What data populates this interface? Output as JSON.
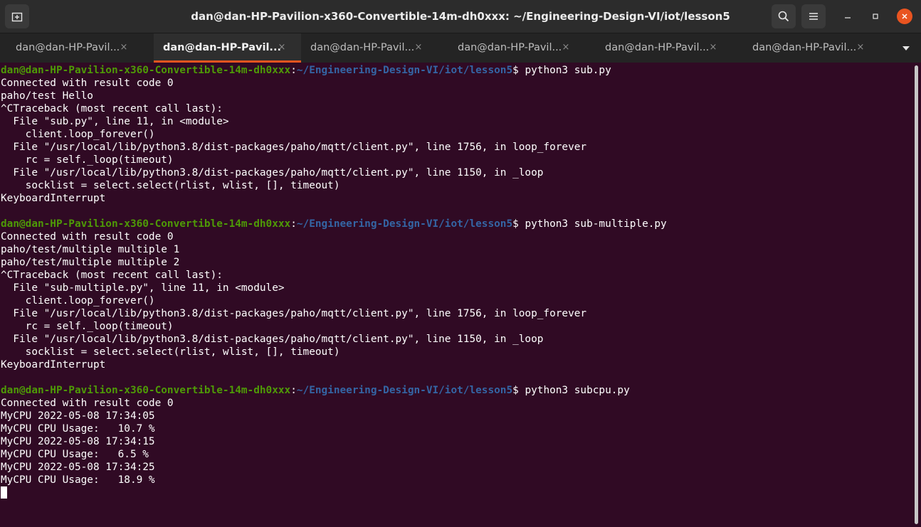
{
  "window": {
    "title": "dan@dan-HP-Pavilion-x360-Convertible-14m-dh0xxx: ~/Engineering-Design-VI/iot/lesson5",
    "icons": {
      "new_tab": "new-tab-icon",
      "search": "search-icon",
      "menu": "hamburger-menu-icon",
      "minimize": "minimize-icon",
      "maximize": "maximize-icon",
      "close": "close-icon"
    },
    "close_color": "#e95420"
  },
  "tabs": [
    {
      "label": "dan@dan-HP-Pavil...",
      "active": false
    },
    {
      "label": "dan@dan-HP-Pavil...",
      "active": true
    },
    {
      "label": "dan@dan-HP-Pavil...",
      "active": false
    },
    {
      "label": "dan@dan-HP-Pavil...",
      "active": false
    },
    {
      "label": "dan@dan-HP-Pavil...",
      "active": false
    },
    {
      "label": "dan@dan-HP-Pavil...",
      "active": false
    }
  ],
  "tab_close_glyph": "×",
  "terminal": {
    "background": "#300a24",
    "prompt_user": "dan@dan-HP-Pavilion-x360-Convertible-14m-dh0xxx",
    "prompt_sep": ":",
    "prompt_path": "~/Engineering-Design-VI/iot/lesson5",
    "prompt_dollar": "$ ",
    "lines": [
      {
        "type": "prompt",
        "cmd": "python3 sub.py"
      },
      {
        "type": "text",
        "text": "Connected with result code 0"
      },
      {
        "type": "text",
        "text": "paho/test Hello"
      },
      {
        "type": "text",
        "text": "^CTraceback (most recent call last):"
      },
      {
        "type": "text",
        "text": "  File \"sub.py\", line 11, in <module>"
      },
      {
        "type": "text",
        "text": "    client.loop_forever()"
      },
      {
        "type": "text",
        "text": "  File \"/usr/local/lib/python3.8/dist-packages/paho/mqtt/client.py\", line 1756, in loop_forever"
      },
      {
        "type": "text",
        "text": "    rc = self._loop(timeout)"
      },
      {
        "type": "text",
        "text": "  File \"/usr/local/lib/python3.8/dist-packages/paho/mqtt/client.py\", line 1150, in _loop"
      },
      {
        "type": "text",
        "text": "    socklist = select.select(rlist, wlist, [], timeout)"
      },
      {
        "type": "text",
        "text": "KeyboardInterrupt"
      },
      {
        "type": "text",
        "text": ""
      },
      {
        "type": "prompt",
        "cmd": "python3 sub-multiple.py"
      },
      {
        "type": "text",
        "text": "Connected with result code 0"
      },
      {
        "type": "text",
        "text": "paho/test/multiple multiple 1"
      },
      {
        "type": "text",
        "text": "paho/test/multiple multiple 2"
      },
      {
        "type": "text",
        "text": "^CTraceback (most recent call last):"
      },
      {
        "type": "text",
        "text": "  File \"sub-multiple.py\", line 11, in <module>"
      },
      {
        "type": "text",
        "text": "    client.loop_forever()"
      },
      {
        "type": "text",
        "text": "  File \"/usr/local/lib/python3.8/dist-packages/paho/mqtt/client.py\", line 1756, in loop_forever"
      },
      {
        "type": "text",
        "text": "    rc = self._loop(timeout)"
      },
      {
        "type": "text",
        "text": "  File \"/usr/local/lib/python3.8/dist-packages/paho/mqtt/client.py\", line 1150, in _loop"
      },
      {
        "type": "text",
        "text": "    socklist = select.select(rlist, wlist, [], timeout)"
      },
      {
        "type": "text",
        "text": "KeyboardInterrupt"
      },
      {
        "type": "text",
        "text": ""
      },
      {
        "type": "prompt",
        "cmd": "python3 subcpu.py"
      },
      {
        "type": "text",
        "text": "Connected with result code 0"
      },
      {
        "type": "text",
        "text": "MyCPU 2022-05-08 17:34:05"
      },
      {
        "type": "text",
        "text": "MyCPU CPU Usage:   10.7 %"
      },
      {
        "type": "text",
        "text": "MyCPU 2022-05-08 17:34:15"
      },
      {
        "type": "text",
        "text": "MyCPU CPU Usage:   6.5 %"
      },
      {
        "type": "text",
        "text": "MyCPU 2022-05-08 17:34:25"
      },
      {
        "type": "text",
        "text": "MyCPU CPU Usage:   18.9 %"
      }
    ]
  }
}
